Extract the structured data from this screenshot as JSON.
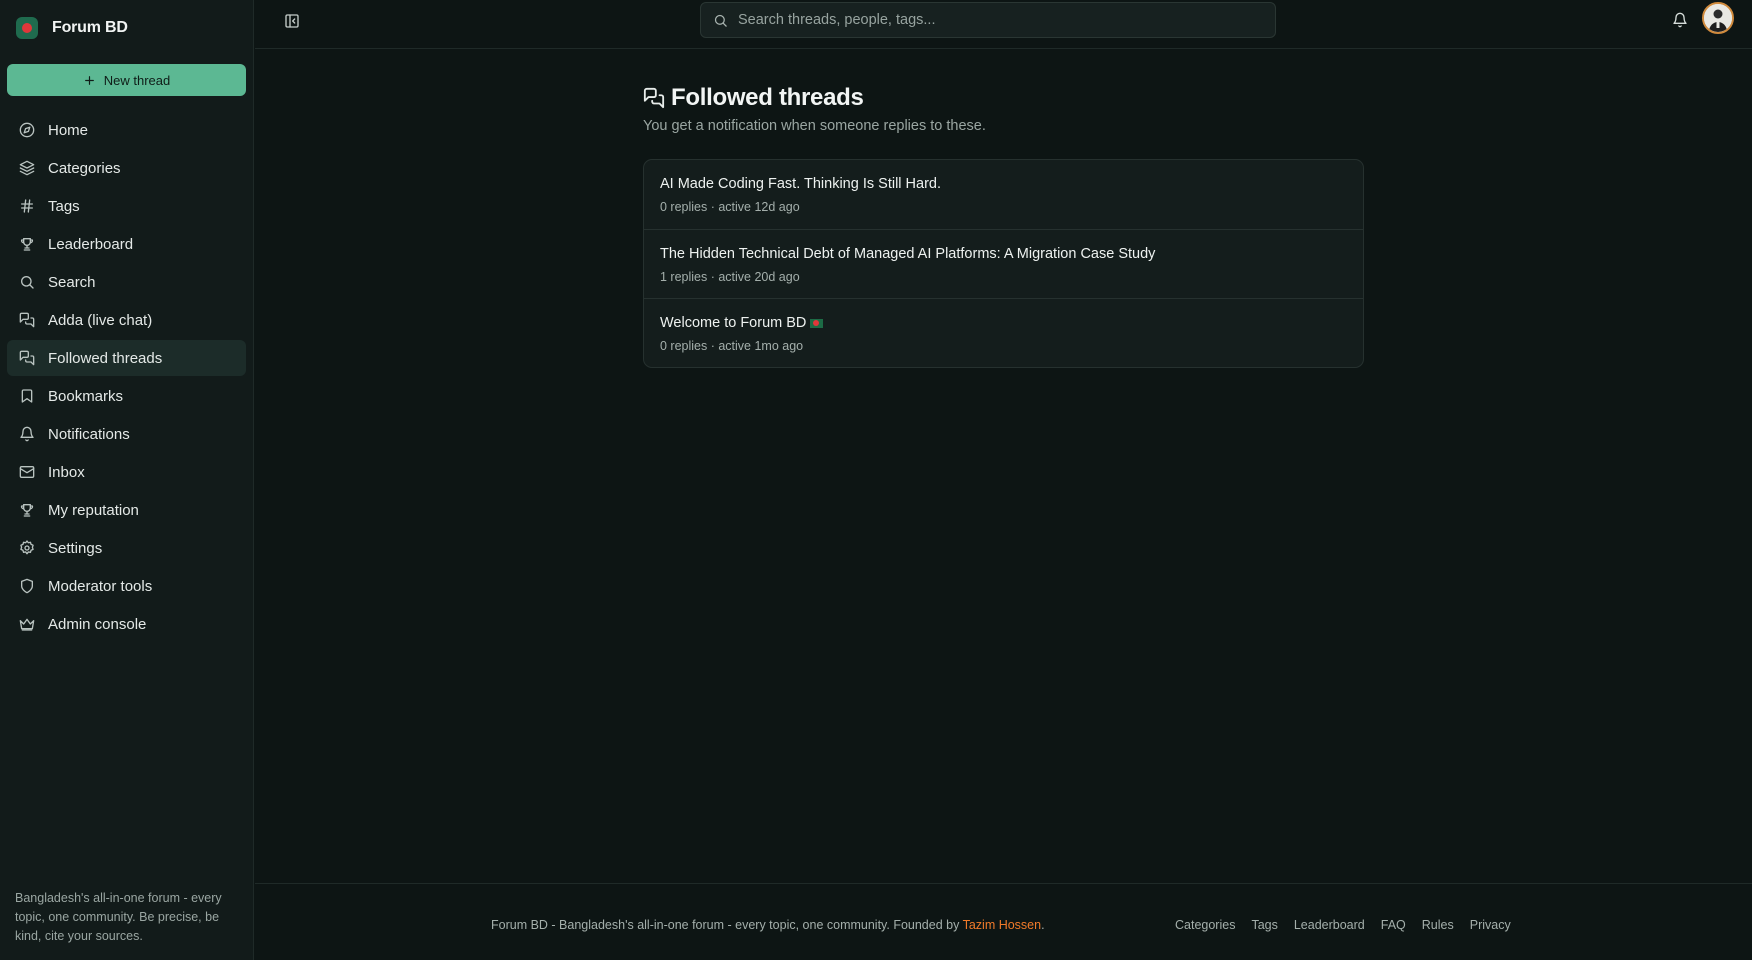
{
  "app": {
    "name": "Forum BD"
  },
  "sidebar": {
    "new_thread_label": "New thread",
    "items": [
      {
        "label": "Home",
        "icon": "compass-icon"
      },
      {
        "label": "Categories",
        "icon": "layers-icon"
      },
      {
        "label": "Tags",
        "icon": "hash-icon"
      },
      {
        "label": "Leaderboard",
        "icon": "trophy-icon"
      },
      {
        "label": "Search",
        "icon": "search-icon"
      },
      {
        "label": "Adda (live chat)",
        "icon": "chat-icon"
      },
      {
        "label": "Followed threads",
        "icon": "chat-icon",
        "active": true
      },
      {
        "label": "Bookmarks",
        "icon": "bookmark-icon"
      },
      {
        "label": "Notifications",
        "icon": "bell-icon"
      },
      {
        "label": "Inbox",
        "icon": "mail-icon"
      },
      {
        "label": "My reputation",
        "icon": "trophy-icon"
      },
      {
        "label": "Settings",
        "icon": "gear-icon"
      },
      {
        "label": "Moderator tools",
        "icon": "shield-icon"
      },
      {
        "label": "Admin console",
        "icon": "crown-icon"
      }
    ],
    "tagline": "Bangladesh's all-in-one forum - every topic, one community. Be precise, be kind, cite your sources."
  },
  "topbar": {
    "search_placeholder": "Search threads, people, tags..."
  },
  "main": {
    "title": "Followed threads",
    "subtitle": "You get a notification when someone replies to these.",
    "threads": [
      {
        "title": "AI Made Coding Fast. Thinking Is Still Hard.",
        "meta": "0 replies · active 12d ago"
      },
      {
        "title": "The Hidden Technical Debt of Managed AI Platforms: A Migration Case Study",
        "meta": "1 replies · active 20d ago"
      },
      {
        "title": "Welcome to Forum BD",
        "meta": "0 replies · active 1mo ago",
        "flag": "bangladesh-flag"
      }
    ]
  },
  "footer": {
    "text": "Forum BD - Bangladesh's all-in-one forum - every topic, one community. Founded by",
    "founder": "Tazim Hossen",
    "links": [
      "Categories",
      "Tags",
      "Leaderboard",
      "FAQ",
      "Rules",
      "Privacy"
    ]
  },
  "colors": {
    "accent": "#5cb893",
    "founder_link": "#f07a2a",
    "background": "#0d1514"
  }
}
